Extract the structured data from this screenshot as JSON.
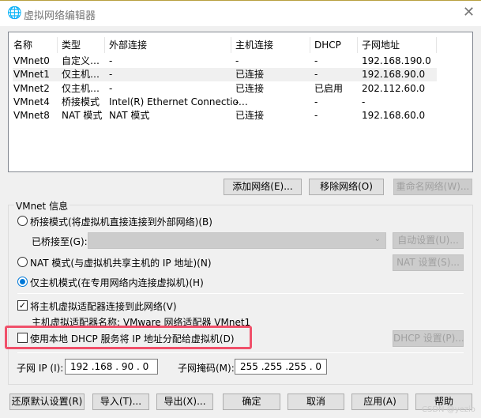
{
  "window": {
    "title": "虚拟网络编辑器",
    "icon": "globe-network-icon",
    "close_icon": "close-icon"
  },
  "table": {
    "headers": [
      "名称",
      "类型",
      "外部连接",
      "主机连接",
      "DHCP",
      "子网地址"
    ],
    "rows": [
      [
        "VMnet0",
        "自定义…",
        "-",
        "-",
        "-",
        "192.168.190.0"
      ],
      [
        "VMnet1",
        "仅主机…",
        "-",
        "已连接",
        "-",
        "192.168.90.0"
      ],
      [
        "VMnet2",
        "仅主机…",
        "-",
        "已连接",
        "已启用",
        "202.112.60.0"
      ],
      [
        "VMnet4",
        "桥接模式",
        "Intel(R) Ethernet Connectio…",
        "-",
        "-",
        "-"
      ],
      [
        "VMnet8",
        "NAT 模式",
        "NAT 模式",
        "已连接",
        "-",
        "192.168.60.0"
      ]
    ],
    "selected_row": 1
  },
  "table_buttons": {
    "add": "添加网络(E)...",
    "remove": "移除网络(O)",
    "rename": "重命名网络(W)..."
  },
  "vmnet_info": {
    "label": "VMnet 信息",
    "bridged": "桥接模式(将虚拟机直接连接到外部网络)(B)",
    "bridged_to_label": "已桥接至(G):",
    "bridged_to_value": "",
    "auto_settings": "自动设置(U)...",
    "nat": "NAT 模式(与虚拟机共享主机的 IP 地址)(N)",
    "nat_settings": "NAT 设置(S)...",
    "hostonly": "仅主机模式(在专用网络内连接虚拟机)(H)",
    "selected_mode": "hostonly",
    "connect_adapter": "将主机虚拟适配器连接到此网络(V)",
    "connect_adapter_checked": true,
    "adapter_name": "主机虚拟适配器名称: VMware 网络适配器 VMnet1",
    "dhcp": "使用本地 DHCP 服务将 IP 地址分配给虚拟机(D)",
    "dhcp_checked": false,
    "dhcp_settings": "DHCP 设置(P)...",
    "subnet_ip_label": "子网 IP (I):",
    "subnet_ip": "192 .168 . 90  .  0",
    "subnet_mask_label": "子网掩码(M):",
    "subnet_mask": "255 .255 .255 .  0",
    "highlight_color": "#f0506a"
  },
  "footer": {
    "restore": "还原默认设置(R)",
    "import": "导入(T)...",
    "export": "导出(X)...",
    "ok": "确定",
    "cancel": "取消",
    "apply": "应用(A)",
    "help": "帮助"
  },
  "watermark": "CSDN @yezio"
}
